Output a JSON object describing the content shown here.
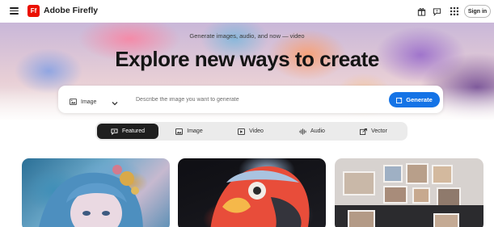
{
  "header": {
    "brand_name": "Adobe Firefly",
    "logo_text": "Ff",
    "signin_label": "Sign in",
    "icons": [
      "menu-icon",
      "gift-icon",
      "chat-icon",
      "apps-grid-icon"
    ]
  },
  "hero": {
    "subtitle": "Generate images, audio, and now — video",
    "title": "Explore new ways to create"
  },
  "prompt": {
    "type_label": "Image",
    "placeholder": "Describe the image you want to generate",
    "value": "",
    "generate_label": "Generate"
  },
  "tabs": [
    {
      "label": "Featured",
      "icon": "featured-icon",
      "active": true
    },
    {
      "label": "Image",
      "icon": "image-icon",
      "active": false
    },
    {
      "label": "Video",
      "icon": "video-icon",
      "active": false
    },
    {
      "label": "Audio",
      "icon": "audio-icon",
      "active": false
    },
    {
      "label": "Vector",
      "icon": "vector-icon",
      "active": false
    }
  ],
  "colors": {
    "accent": "#1473e6",
    "brand": "#eb1000",
    "active_tab": "#1f1f1f"
  }
}
